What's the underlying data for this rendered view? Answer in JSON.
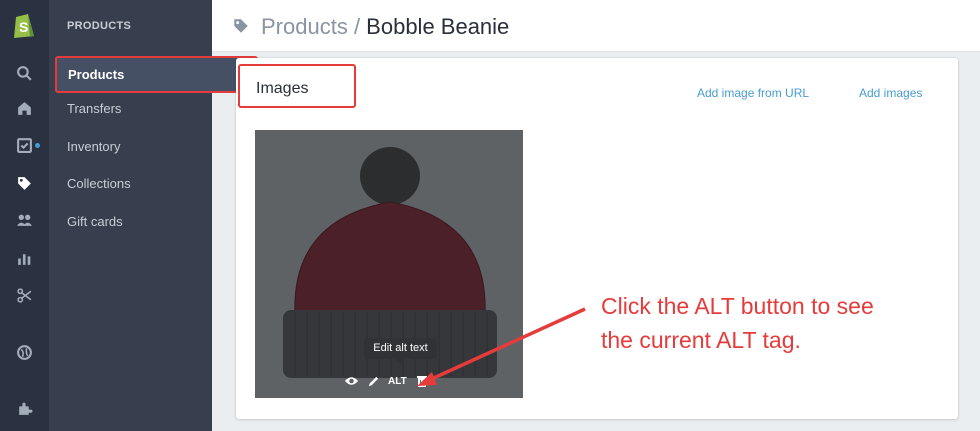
{
  "rail": {
    "icons": [
      "shopify-logo-icon",
      "search-icon",
      "home-icon",
      "orders-icon",
      "products-tag-icon",
      "customers-icon",
      "reports-icon",
      "discounts-icon",
      "online-store-icon",
      "apps-icon"
    ]
  },
  "subnav": {
    "section_title": "PRODUCTS",
    "items": [
      {
        "label": "Products",
        "active": true
      },
      {
        "label": "Transfers",
        "active": false
      },
      {
        "label": "Inventory",
        "active": false
      },
      {
        "label": "Collections",
        "active": false
      },
      {
        "label": "Gift cards",
        "active": false
      }
    ]
  },
  "header": {
    "breadcrumb_parent": "Products",
    "separator": " / ",
    "current": "Bobble Beanie"
  },
  "images_card": {
    "title": "Images",
    "add_from_url": "Add image from URL",
    "add_images": "Add images",
    "tooltip": "Edit alt text",
    "alt_button": "ALT"
  },
  "annotation": {
    "line1": "Click the ALT button to see",
    "line2": "the current ALT tag."
  },
  "colors": {
    "accent_red": "#e63b3b",
    "link_blue": "#479ccf",
    "rail_bg": "#2a3140",
    "subnav_bg": "#373e4e"
  }
}
